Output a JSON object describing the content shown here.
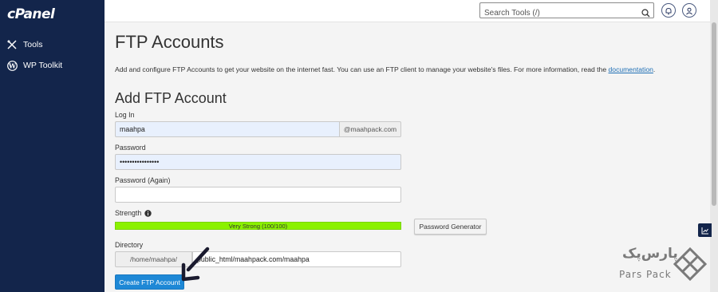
{
  "sidebar": {
    "brand": "cPanel",
    "items": [
      {
        "label": "Tools",
        "icon": "tools-icon"
      },
      {
        "label": "WP Toolkit",
        "icon": "wordpress-icon"
      }
    ]
  },
  "topbar": {
    "search_placeholder": "Search Tools (/)"
  },
  "main": {
    "title": "FTP Accounts",
    "description": "Add and configure FTP Accounts to get your website on the internet fast. You can use an FTP client to manage your website's files. For more information, read the",
    "description_link": "documentation",
    "description_end": ".",
    "section_title": "Add FTP Account",
    "login_label": "Log In",
    "login_value": "maahpa",
    "login_domain": "@maahpack.com",
    "password_label": "Password",
    "password_value": "••••••••••••••••",
    "password_again_label": "Password (Again)",
    "password_again_value": "",
    "strength_label": "Strength",
    "strength_text": "Very Strong (100/100)",
    "strength_percent": 100,
    "password_generator_label": "Password Generator",
    "directory_label": "Directory",
    "directory_prefix": "/home/maahpa/",
    "directory_value": "public_html/maahpack.com/maahpa",
    "create_button_label": "Create FTP Account"
  },
  "watermark": {
    "persian": "پارس‌پک",
    "english": "Pars Pack"
  },
  "colors": {
    "sidebar_bg": "#13254b",
    "strength_bar": "#8bf100",
    "primary_button": "#1e88d6",
    "link": "#1f6fb5"
  }
}
